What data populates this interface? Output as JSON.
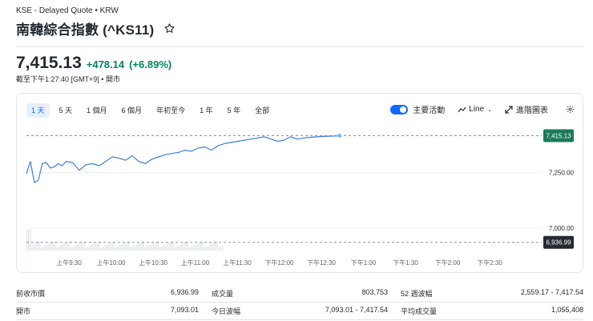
{
  "header": {
    "exchange_line": "KSE - Delayed Quote • KRW",
    "title": "南韓綜合指數 (^KS11)"
  },
  "quote": {
    "price": "7,415.13",
    "change": "+478.14",
    "change_pct": "(+6.89%)",
    "as_of": "截至下午1:27:40 [GMT+9] • 開市"
  },
  "colors": {
    "accent": "#0f69ff",
    "positive": "#008463",
    "line": "#3b7ddd",
    "text": "#232a31",
    "price_tag_bg": "#1b7a5a",
    "prev_close_tag_bg": "#232a31"
  },
  "range_tabs": [
    "1 天",
    "5 天",
    "1 個月",
    "6 個月",
    "年初至今",
    "1 年",
    "5 年",
    "全部"
  ],
  "toolbar": {
    "key_events_label": "主要活動",
    "chart_type_label": "Line",
    "advanced_label": "進階圖表",
    "settings_icon": "gear-icon"
  },
  "chart_data": {
    "type": "line",
    "x_ticks": [
      "上午9:30",
      "上午10:00",
      "上午10:30",
      "上午11:00",
      "上午11:30",
      "下午12:00",
      "下午12:30",
      "下午1:00",
      "下午1:30",
      "下午2:00",
      "下午2:30"
    ],
    "y_ticks": [
      "7,250.00",
      "7,000.00"
    ],
    "last_price_label": "7,415.13",
    "prev_close_label": "6,936.99",
    "ylim": [
      6900,
      7460
    ],
    "series": [
      {
        "t": [
          0,
          3,
          6,
          9,
          12,
          15,
          18,
          21,
          24,
          27,
          30,
          35,
          40,
          45,
          50,
          55,
          60,
          65,
          70,
          75,
          80,
          85,
          90,
          95,
          100,
          105,
          110,
          115,
          120,
          125,
          130,
          135,
          140,
          145,
          150,
          155,
          160,
          165,
          170,
          175,
          180,
          185,
          190,
          195,
          200,
          205,
          210,
          215,
          220,
          225,
          230,
          235,
          237
        ],
        "values": [
          7245,
          7300,
          7205,
          7215,
          7290,
          7295,
          7270,
          7275,
          7290,
          7280,
          7300,
          7295,
          7260,
          7285,
          7290,
          7280,
          7300,
          7320,
          7315,
          7305,
          7325,
          7300,
          7290,
          7310,
          7320,
          7330,
          7335,
          7340,
          7350,
          7345,
          7360,
          7365,
          7350,
          7370,
          7380,
          7385,
          7390,
          7395,
          7400,
          7405,
          7410,
          7400,
          7390,
          7395,
          7410,
          7400,
          7405,
          7408,
          7410,
          7412,
          7413,
          7414,
          7415.13
        ]
      }
    ],
    "prev_close": 6936.99,
    "grid": "horizontal"
  },
  "stats": [
    [
      {
        "label": "前收市價",
        "value": "6,936.99"
      },
      {
        "label": "成交量",
        "value": "803,753"
      },
      {
        "label": "52 週波幅",
        "value": "2,559.17 - 7,417.54"
      }
    ],
    [
      {
        "label": "開市",
        "value": "7,093.01"
      },
      {
        "label": "今日波幅",
        "value": "7,093.01 - 7,417.54"
      },
      {
        "label": "平均成交量",
        "value": "1,055,408"
      }
    ]
  ]
}
